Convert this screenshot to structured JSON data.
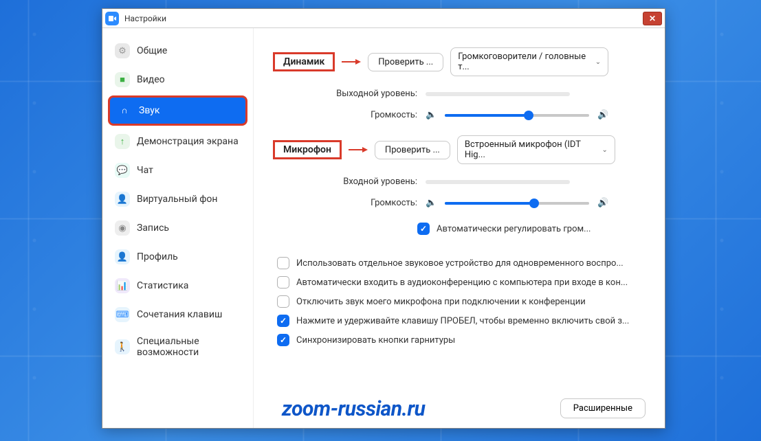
{
  "window": {
    "title": "Настройки"
  },
  "sidebar": {
    "items": [
      {
        "label": "Общие",
        "icon": "gear-icon",
        "bg": "#e8e8e8",
        "glyph": "⚙",
        "glyphColor": "#999"
      },
      {
        "label": "Видео",
        "icon": "video-icon",
        "bg": "#e9f5ea",
        "glyph": "■",
        "glyphColor": "#3cb043"
      },
      {
        "label": "Звук",
        "icon": "headphones-icon",
        "bg": "transparent",
        "glyph": "∩",
        "glyphColor": "#fff",
        "active": true,
        "highlighted": true
      },
      {
        "label": "Демонстрация экрана",
        "icon": "share-icon",
        "bg": "#e9f5ea",
        "glyph": "↑",
        "glyphColor": "#3cb043"
      },
      {
        "label": "Чат",
        "icon": "chat-icon",
        "bg": "#e8fbf6",
        "glyph": "💬",
        "glyphColor": "#1abc9c"
      },
      {
        "label": "Виртуальный фон",
        "icon": "background-icon",
        "bg": "#e6f4fd",
        "glyph": "👤",
        "glyphColor": "#2d8cff"
      },
      {
        "label": "Запись",
        "icon": "record-icon",
        "bg": "#eee",
        "glyph": "◉",
        "glyphColor": "#888"
      },
      {
        "label": "Профиль",
        "icon": "profile-icon",
        "bg": "#e6f4fd",
        "glyph": "👤",
        "glyphColor": "#2d8cff"
      },
      {
        "label": "Статистика",
        "icon": "stats-icon",
        "bg": "#f0e9fb",
        "glyph": "📊",
        "glyphColor": "#8d5bd6"
      },
      {
        "label": "Сочетания клавиш",
        "icon": "keyboard-icon",
        "bg": "#e6f4fd",
        "glyph": "⌨",
        "glyphColor": "#2d8cff"
      },
      {
        "label": "Специальные возможности",
        "icon": "accessibility-icon",
        "bg": "#e6f4fd",
        "glyph": "🚶",
        "glyphColor": "#2d8cff"
      }
    ]
  },
  "speaker": {
    "heading": "Динамик",
    "test_button": "Проверить ...",
    "device": "Громкоговорители / головные т...",
    "level_label": "Выходной уровень:",
    "volume_label": "Громкость:",
    "volume_percent": 58
  },
  "microphone": {
    "heading": "Микрофон",
    "test_button": "Проверить ...",
    "device": "Встроенный микрофон (IDT Hig...",
    "level_label": "Входной уровень:",
    "volume_label": "Громкость:",
    "volume_percent": 62,
    "auto_adjust_label": "Автоматически регулировать гром...",
    "auto_adjust_checked": true
  },
  "options": [
    {
      "label": "Использовать отдельное звуковое устройство для одновременного воспро...",
      "checked": false
    },
    {
      "label": "Автоматически входить в аудиоконференцию с компьютера при входе в кон...",
      "checked": false
    },
    {
      "label": "Отключить звук моего микрофона при подключении к конференции",
      "checked": false
    },
    {
      "label": "Нажмите и удерживайте клавишу ПРОБЕЛ, чтобы временно включить свой з...",
      "checked": true
    },
    {
      "label": "Синхронизировать кнопки гарнитуры",
      "checked": true
    }
  ],
  "advanced_button": "Расширенные",
  "watermark": "zoom-russian.ru"
}
